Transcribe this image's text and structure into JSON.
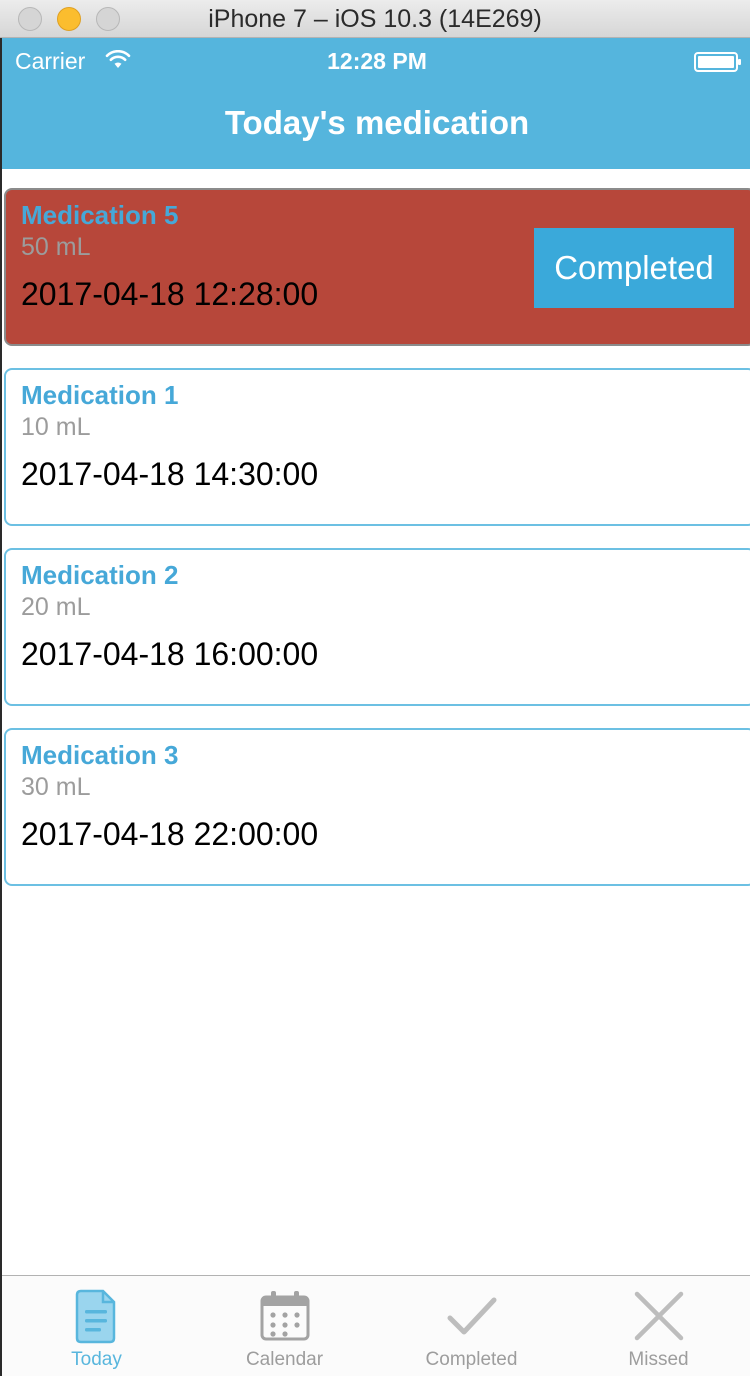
{
  "window": {
    "title": "iPhone 7 – iOS 10.3 (14E269)"
  },
  "status_bar": {
    "carrier": "Carrier",
    "time": "12:28 PM"
  },
  "header": {
    "title": "Today's medication"
  },
  "colors": {
    "header_bg": "#55b5dd",
    "accent_blue": "#46a8d8",
    "active_card_bg": "#b7473a",
    "complete_button_bg": "#3aa9da",
    "tab_selected": "#58b6dd",
    "tab_unselected": "#9d9d9d"
  },
  "medications": [
    {
      "name": "Medication 5",
      "dose": "50 mL",
      "time": "2017-04-18 12:28:00",
      "state": "due",
      "action_label": "Completed"
    },
    {
      "name": "Medication 1",
      "dose": "10 mL",
      "time": "2017-04-18 14:30:00",
      "state": "upcoming"
    },
    {
      "name": "Medication 2",
      "dose": "20 mL",
      "time": "2017-04-18 16:00:00",
      "state": "upcoming"
    },
    {
      "name": "Medication 3",
      "dose": "30 mL",
      "time": "2017-04-18 22:00:00",
      "state": "upcoming"
    }
  ],
  "tabs": [
    {
      "label": "Today",
      "icon": "document-icon",
      "selected": true
    },
    {
      "label": "Calendar",
      "icon": "calendar-icon",
      "selected": false
    },
    {
      "label": "Completed",
      "icon": "checkmark-icon",
      "selected": false
    },
    {
      "label": "Missed",
      "icon": "x-icon",
      "selected": false
    }
  ]
}
